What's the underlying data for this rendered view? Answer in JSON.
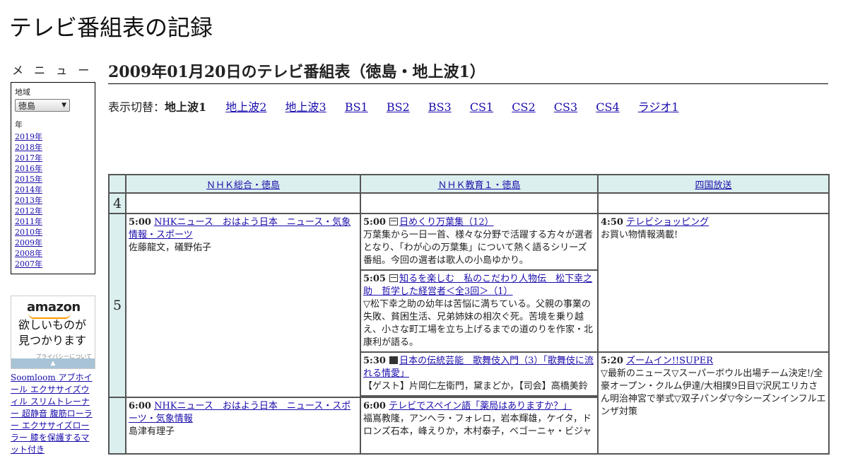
{
  "site": {
    "title": "テレビ番組表の記録"
  },
  "sidebar": {
    "menu_heading": "メ ニ ュ ー",
    "region_label": "地域",
    "region_value": "徳島",
    "year_label": "年",
    "years": [
      "2019年",
      "2018年",
      "2017年",
      "2016年",
      "2015年",
      "2014年",
      "2013年",
      "2012年",
      "2011年",
      "2010年",
      "2009年",
      "2008年",
      "2007年"
    ],
    "ad": {
      "logo": "amazon",
      "line1": "欲しいものが",
      "line2": "見つかります",
      "privacy": "プライバシーについて"
    },
    "links": [
      "Soomloom アブホイール エクササイズウィル スリムトレーナー 超静音 腹筋ローラー エクササイズローラー 膝を保護するマット付き"
    ]
  },
  "main": {
    "title": "2009年01月20日のテレビ番組表（徳島・地上波1）",
    "switch_label": "表示切替：",
    "current": "地上波1",
    "switch_links": [
      "地上波2",
      "地上波3",
      "BS1",
      "BS2",
      "BS3",
      "CS1",
      "CS2",
      "CS3",
      "CS4",
      "ラジオ1"
    ]
  },
  "grid": {
    "channels": [
      "ＮＨＫ総合・徳島",
      "ＮＨＫ教育１・徳島",
      "四国放送"
    ],
    "hours": [
      "4",
      "5"
    ],
    "programs": {
      "nhk_500": {
        "time": "5:00",
        "title": "NHKニュース　おはよう日本　ニュース・気象情報・スポーツ",
        "desc": "佐藤龍文，礒野佑子"
      },
      "nhk_600": {
        "time": "6:00",
        "title": "NHKニュース　おはよう日本　ニュース・スポーツ・気象情報",
        "desc": "島津有理子"
      },
      "edu_500": {
        "time": "5:00",
        "title": "日めくり万葉集（12）",
        "desc": "万葉集から一日一首、様々な分野で活躍する方々が選者となり、「わが心の万葉集」について熱く語るシリーズ番組。今回の選者は歌人の小島ゆかり。"
      },
      "edu_505": {
        "time": "5:05",
        "title": "知るを楽しむ　私のこだわり人物伝　松下幸之助　哲学した経営者＜全3回＞（1）",
        "desc": "▽松下幸之助の幼年は苦悩に満ちている。父親の事業の失敗、貧困生活、兄弟姉妹の相次ぐ死。苦境を乗り越え、小さな町工場を立ち上げるまでの道のりを作家・北康利が語る。"
      },
      "edu_530": {
        "time": "5:30",
        "title": "日本の伝統芸能　歌舞伎入門（3）「歌舞伎に流れる情愛」",
        "desc": "【ゲスト】片岡仁左衛門，黛まどか，【司会】高橋美鈴"
      },
      "edu_600": {
        "time": "6:00",
        "title": "テレビでスペイン語「薬局はありますか？」",
        "desc": "福嶌教隆，アンヘラ・フォレロ，岩本輝雄，ケイタ，ドロンズ石本，峰えりか，木村泰子，ベゴーニャ・ビジャ"
      },
      "jrt_450": {
        "time": "4:50",
        "title": "テレビショッピング",
        "desc": "お買い物情報満載!"
      },
      "jrt_520": {
        "time": "5:20",
        "title": "ズームイン!!SUPER",
        "desc": "▽最新のニュース▽スーパーボウル出場チーム決定!/全豪オープン・クルム伊達/大相撲9日目▽沢尻エリカさん明治神宮で挙式▽双子パンダ▽今シーズンインフルエンザ対策"
      }
    }
  }
}
